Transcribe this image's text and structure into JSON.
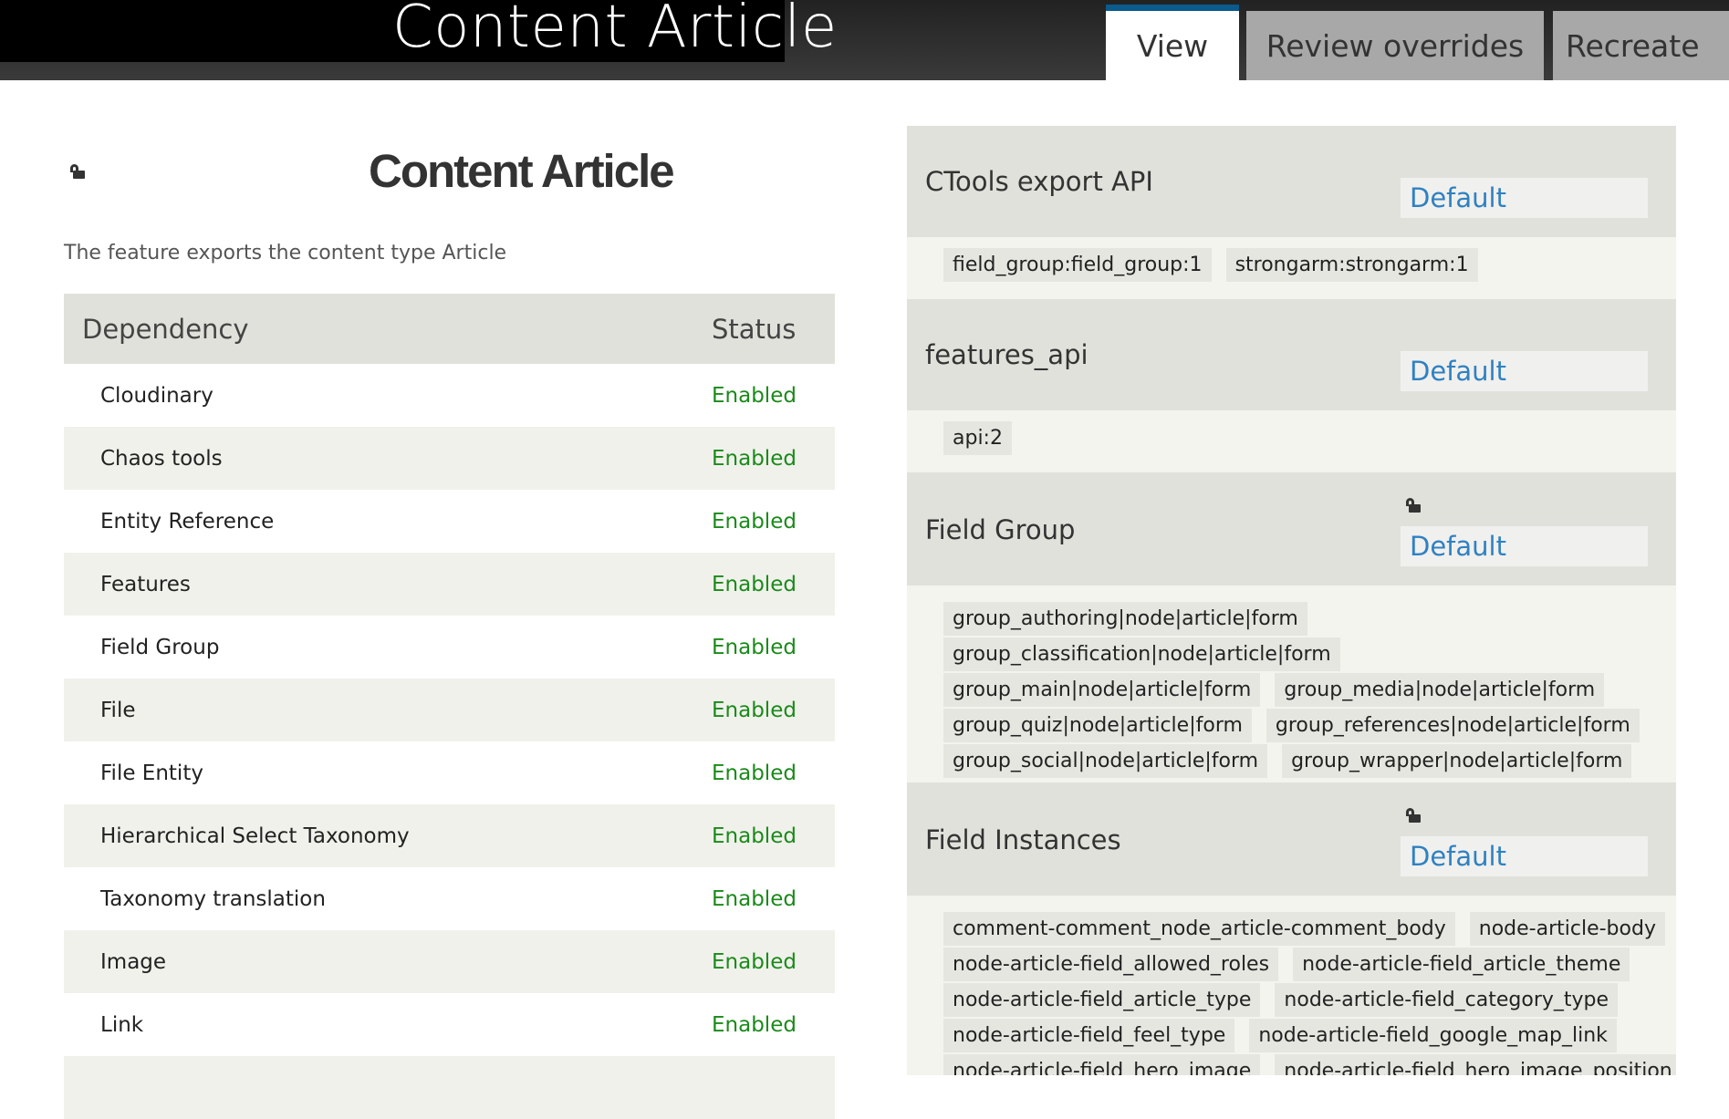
{
  "header": {
    "title": "Content Article",
    "tabs": [
      {
        "label": "View",
        "active": true
      },
      {
        "label": "Review overrides",
        "active": false
      },
      {
        "label": "Recreate",
        "active": false
      }
    ]
  },
  "main": {
    "title": "Content Article",
    "description": "The feature exports the content type Article",
    "table": {
      "headers": [
        "Dependency",
        "Status"
      ],
      "rows": [
        {
          "dependency": "Cloudinary",
          "status": "Enabled"
        },
        {
          "dependency": "Chaos tools",
          "status": "Enabled"
        },
        {
          "dependency": "Entity Reference",
          "status": "Enabled"
        },
        {
          "dependency": "Features",
          "status": "Enabled"
        },
        {
          "dependency": "Field Group",
          "status": "Enabled"
        },
        {
          "dependency": "File",
          "status": "Enabled"
        },
        {
          "dependency": "File Entity",
          "status": "Enabled"
        },
        {
          "dependency": "Hierarchical Select Taxonomy",
          "status": "Enabled"
        },
        {
          "dependency": "Taxonomy translation",
          "status": "Enabled"
        },
        {
          "dependency": "Image",
          "status": "Enabled"
        },
        {
          "dependency": "Link",
          "status": "Enabled"
        }
      ]
    }
  },
  "components": [
    {
      "name": "CTools export API",
      "status": "Default",
      "items": [
        "field_group:field_group:1",
        "strongarm:strongarm:1"
      ]
    },
    {
      "name": "features_api",
      "status": "Default",
      "items": [
        "api:2"
      ]
    },
    {
      "name": "Field Group",
      "status": "Default",
      "items": [
        "group_authoring|node|article|form",
        "group_classification|node|article|form",
        "group_main|node|article|form",
        "group_media|node|article|form",
        "group_quiz|node|article|form",
        "group_references|node|article|form",
        "group_social|node|article|form",
        "group_wrapper|node|article|form"
      ]
    },
    {
      "name": "Field Instances",
      "status": "Default",
      "items": [
        "comment-comment_node_article-comment_body",
        "node-article-body",
        "node-article-field_allowed_roles",
        "node-article-field_article_theme",
        "node-article-field_article_type",
        "node-article-field_category_type",
        "node-article-field_feel_type",
        "node-article-field_google_map_link",
        "node-article-field_hero_image",
        "node-article-field_hero_image_position"
      ]
    }
  ],
  "colors": {
    "accent": "#0a5b8c",
    "enabled": "#1a8a1a",
    "link": "#2f81c2"
  },
  "icons": {
    "lock": "lock-icon"
  }
}
